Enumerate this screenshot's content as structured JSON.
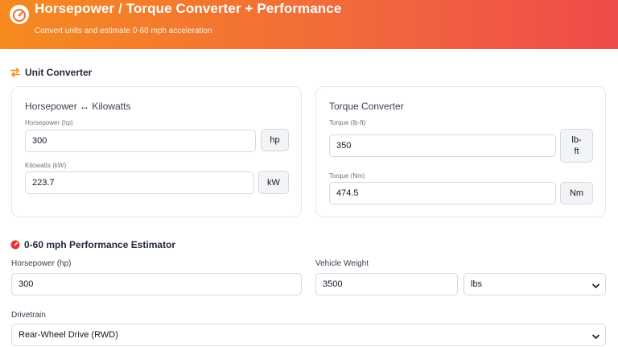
{
  "header": {
    "title": "Horsepower / Torque Converter + Performance",
    "subtitle": "Convert units and estimate 0-60 mph acceleration",
    "icon": "gauge-icon",
    "gradient": [
      "#f58a1f",
      "#ee4b4b"
    ]
  },
  "unit_converter": {
    "title": "Unit Converter",
    "icon": "swap-arrows-icon",
    "hp_kw": {
      "title": "Horsepower ↔ Kilowatts",
      "hp_label": "Horsepower (hp)",
      "hp_value": "300",
      "hp_unit": "hp",
      "kw_label": "Kilowatts (kW)",
      "kw_value": "223.7",
      "kw_unit": "kW"
    },
    "torque": {
      "title": "Torque Converter",
      "lbft_label": "Torque (lb-ft)",
      "lbft_value": "350",
      "lbft_unit_line1": "lb-",
      "lbft_unit_line2": "ft",
      "nm_label": "Torque (Nm)",
      "nm_value": "474.5",
      "nm_unit": "Nm"
    }
  },
  "estimator": {
    "title": "0-60 mph Performance Estimator",
    "icon": "stopwatch-icon",
    "hp_label": "Horsepower (hp)",
    "hp_value": "300",
    "weight_label": "Vehicle Weight",
    "weight_value": "3500",
    "weight_unit": "lbs",
    "drivetrain_label": "Drivetrain",
    "drivetrain_value": "Rear-Wheel Drive (RWD)"
  },
  "colors": {
    "accent_orange": "#f58a1f",
    "accent_red": "#ee4b4b",
    "border": "#d6d9de"
  }
}
